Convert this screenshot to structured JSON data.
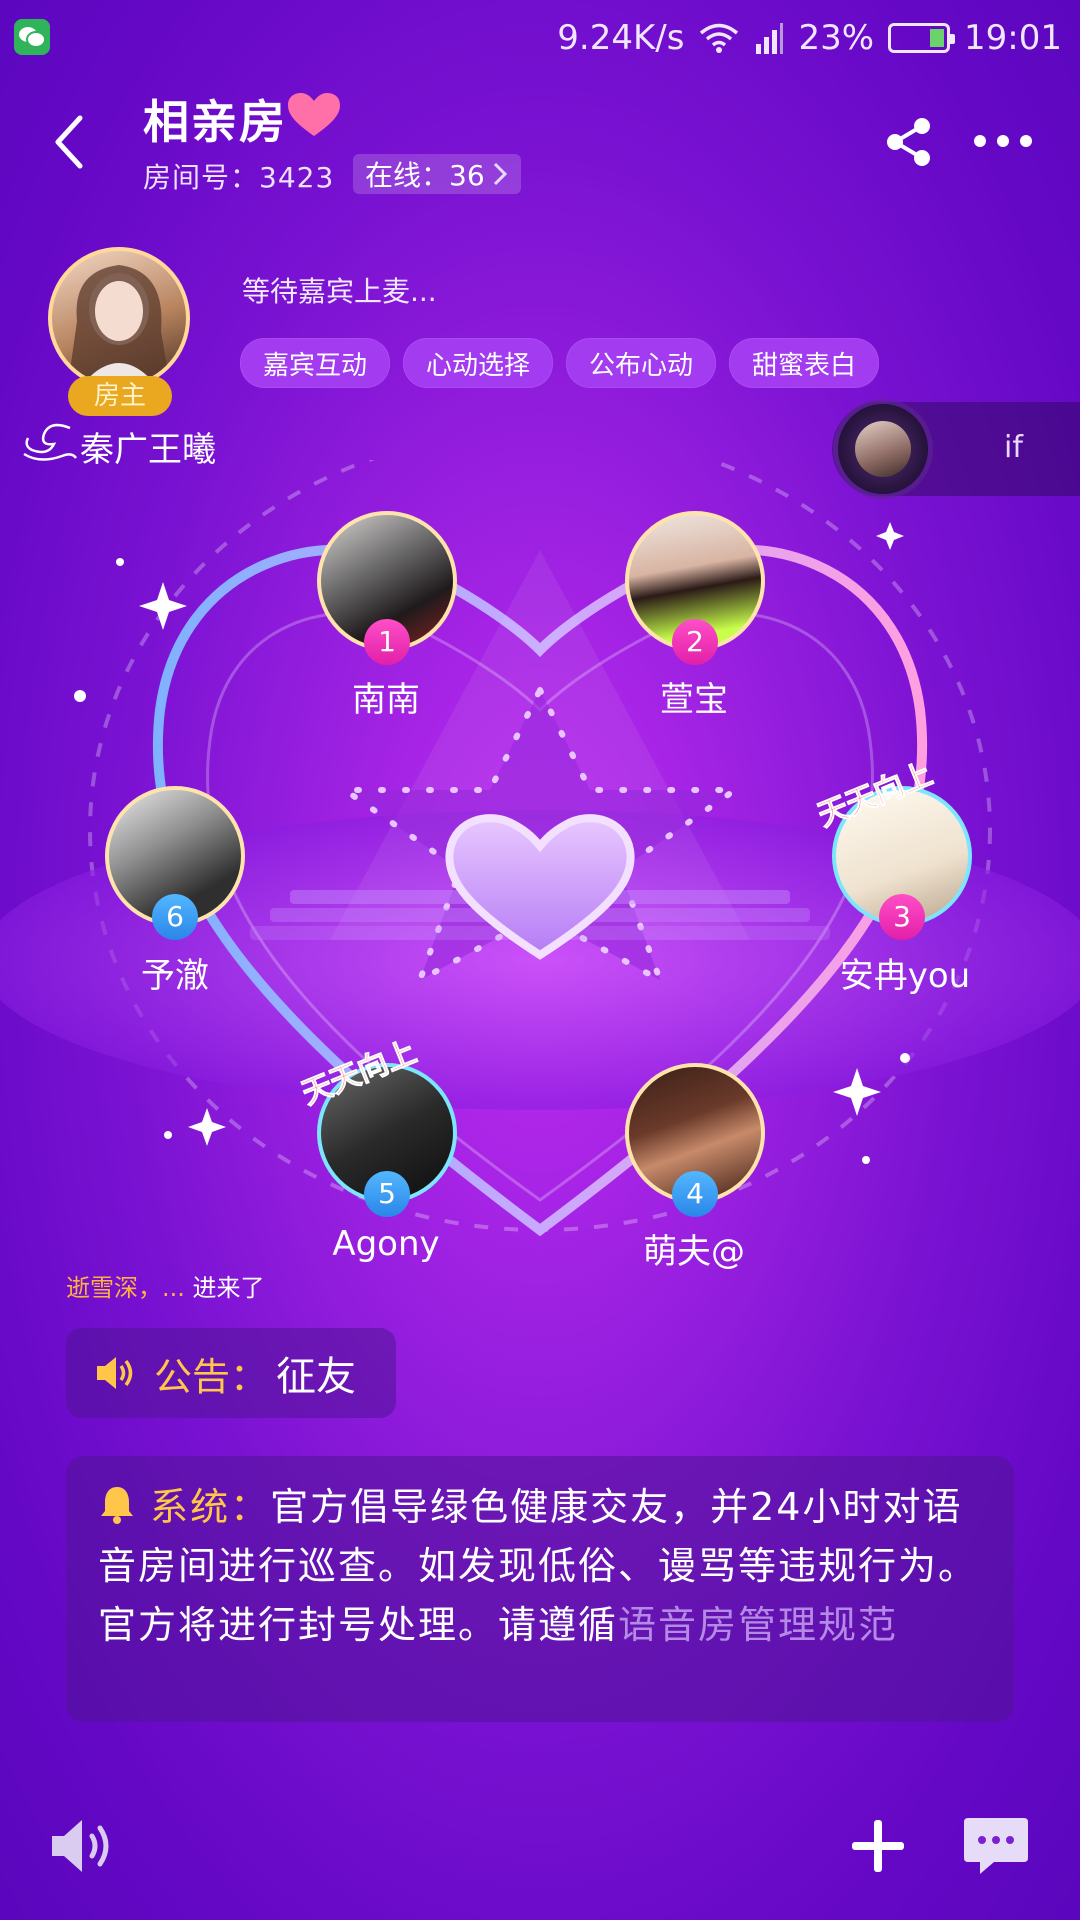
{
  "status_bar": {
    "net_speed": "9.24K/s",
    "battery": "23%",
    "time": "19:01"
  },
  "header": {
    "title": "相亲房",
    "room_label": "房间号：3423",
    "online_label": "在线：36"
  },
  "host": {
    "badge": "房主",
    "name": "秦广王曦",
    "waiting_text": "等待嘉宾上麦...",
    "actions": [
      "嘉宾互动",
      "心动选择",
      "公布心动",
      "甜蜜表白"
    ]
  },
  "float_user": {
    "name": "if"
  },
  "seats": [
    {
      "num": "1",
      "name": "南南"
    },
    {
      "num": "2",
      "name": "萱宝"
    },
    {
      "num": "3",
      "name": "安冉you",
      "sticker": "天天向上"
    },
    {
      "num": "4",
      "name": "萌夫@"
    },
    {
      "num": "5",
      "name": "Agony",
      "sticker": "天天向上"
    },
    {
      "num": "6",
      "name": "予澈"
    }
  ],
  "join_message": {
    "who": "逝雪深，...",
    "action": "进来了"
  },
  "notice": {
    "label": "公告：",
    "text": "征友"
  },
  "system": {
    "label": "系统：",
    "text": "官方倡导绿色健康交友，并24小时对语音房间进行巡查。如发现低俗、谩骂等违规行为。官方将进行封号处理。请遵循",
    "link": "语音房管理规范"
  },
  "colors": {
    "accent_yellow": "#ffc64a",
    "seat_pink": "#e21fa9",
    "seat_blue": "#2a86e8",
    "host_badge": "#e9a81f"
  },
  "icons": [
    "back-icon",
    "heart-icon",
    "share-icon",
    "more-icon",
    "speaker-icon",
    "bell-icon",
    "plus-icon",
    "chat-icon",
    "wifi-icon",
    "signal-icon",
    "battery-icon",
    "chevron-right-icon"
  ]
}
